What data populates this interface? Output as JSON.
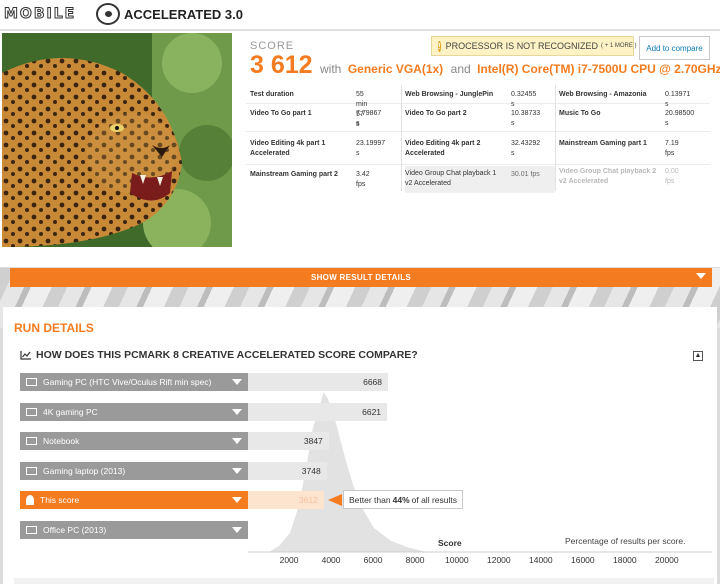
{
  "header": {
    "brand_text": "MOBILE",
    "title": "ACCELERATED 3.0"
  },
  "result": {
    "score_label": "SCORE",
    "score": "3 612",
    "with_text": "with",
    "gpu": "Generic VGA(1x)",
    "and_text": "and",
    "cpu": "Intel(R) Core(TM) i7-7500U CPU @ 2.70GHz",
    "notice_text": "PROCESSOR IS NOT RECOGNIZED",
    "notice_more": "( + 1 MORE )",
    "compare_label": "Add to compare",
    "details": [
      {
        "label": "Test duration",
        "value": "55 min 57 s"
      },
      {
        "label": "Web Browsing - JunglePin",
        "value": "0.32455 s"
      },
      {
        "label": "Web Browsing - Amazonia",
        "value": "0.13971 s"
      },
      {
        "label": "Video To Go part 1",
        "value": "7.79867 s"
      },
      {
        "label": "Video To Go part 2",
        "value": "10.38733 s"
      },
      {
        "label": "Music To Go",
        "value": "20.98500 s"
      },
      {
        "label": "Video Editing 4k part 1 Accelerated",
        "value": "23.19997 s"
      },
      {
        "label": "Video Editing 4k part 2 Accelerated",
        "value": "32.43292 s"
      },
      {
        "label": "Mainstream Gaming part 1",
        "value": "7.19 fps"
      },
      {
        "label": "Mainstream Gaming part 2",
        "value": "3.42 fps"
      },
      {
        "label": "Video Group Chat playback 1 v2 Accelerated",
        "value": "30.01 fps"
      },
      {
        "label": "Video Group Chat playback 2 v2 Accelerated",
        "value": "0.00 fps"
      }
    ]
  },
  "show_details_label": "SHOW RESULT DETAILS",
  "run_details": {
    "title": "RUN DETAILS",
    "compare_title": "HOW DOES THIS PCMARK 8 CREATIVE ACCELERATED SCORE COMPARE?"
  },
  "chart_data": {
    "type": "bar",
    "categories": [
      "Gaming PC (HTC Vive/Oculus Rift min spec)",
      "4K gaming PC",
      "Notebook",
      "Gaming laptop (2013)",
      "This score",
      "Office PC (2013)"
    ],
    "values": [
      6668,
      6621,
      3847,
      3748,
      3612,
      null
    ],
    "highlight": "This score",
    "callout": {
      "prefix": "Better than",
      "percent": "44%",
      "suffix": "of all results"
    },
    "x_ticks": [
      "2000",
      "4000",
      "6000",
      "8000",
      "10000",
      "12000",
      "14000",
      "16000",
      "18000",
      "20000"
    ],
    "xlim": [
      0,
      20000
    ],
    "xlabel": "Score",
    "note": "Percentage of results per score.",
    "distribution": {
      "x": [
        1000,
        1500,
        2000,
        2400,
        2800,
        3100,
        3400,
        3600,
        3800,
        4200,
        4600,
        5000,
        5500,
        6000,
        6800,
        7600,
        8500
      ],
      "y": [
        0,
        0.04,
        0.12,
        0.28,
        0.55,
        0.78,
        0.9,
        1.0,
        0.96,
        0.8,
        0.6,
        0.42,
        0.26,
        0.15,
        0.07,
        0.03,
        0
      ]
    },
    "colors": {
      "accent": "#f47b20",
      "bar": "#9a9a9a",
      "track": "#e8e8e8",
      "curve": "#e2e2e2"
    }
  }
}
